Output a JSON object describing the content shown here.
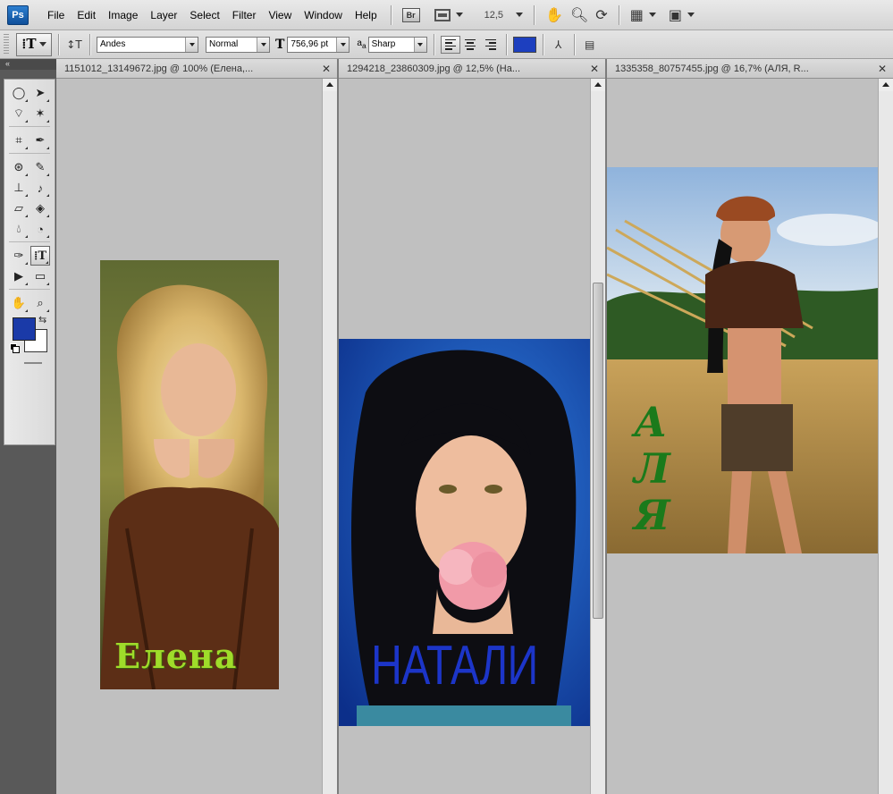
{
  "app": {
    "logo": "Ps",
    "menu": [
      "File",
      "Edit",
      "Image",
      "Layer",
      "Select",
      "Filter",
      "View",
      "Window",
      "Help"
    ],
    "bridge_label": "Br",
    "zoom": "12,5"
  },
  "options": {
    "font_family": "Andes",
    "font_style": "Normal",
    "font_size": "756,96 pt",
    "antialias": "Sharp",
    "text_color": "#1d3fbf"
  },
  "toolbox": {
    "foreground_color": "#1a3aa8",
    "background_color": "#ffffff"
  },
  "documents": [
    {
      "title": "1151012_13149672.jpg @ 100% (Елена,...",
      "caption": "Елена"
    },
    {
      "title": "1294218_23860309.jpg @ 12,5% (На...",
      "caption": "НАТАЛИ"
    },
    {
      "title": "1335358_80757455.jpg @ 16,7% (АЛЯ, R...",
      "caption_letters": [
        "А",
        "Л",
        "Я"
      ]
    }
  ]
}
